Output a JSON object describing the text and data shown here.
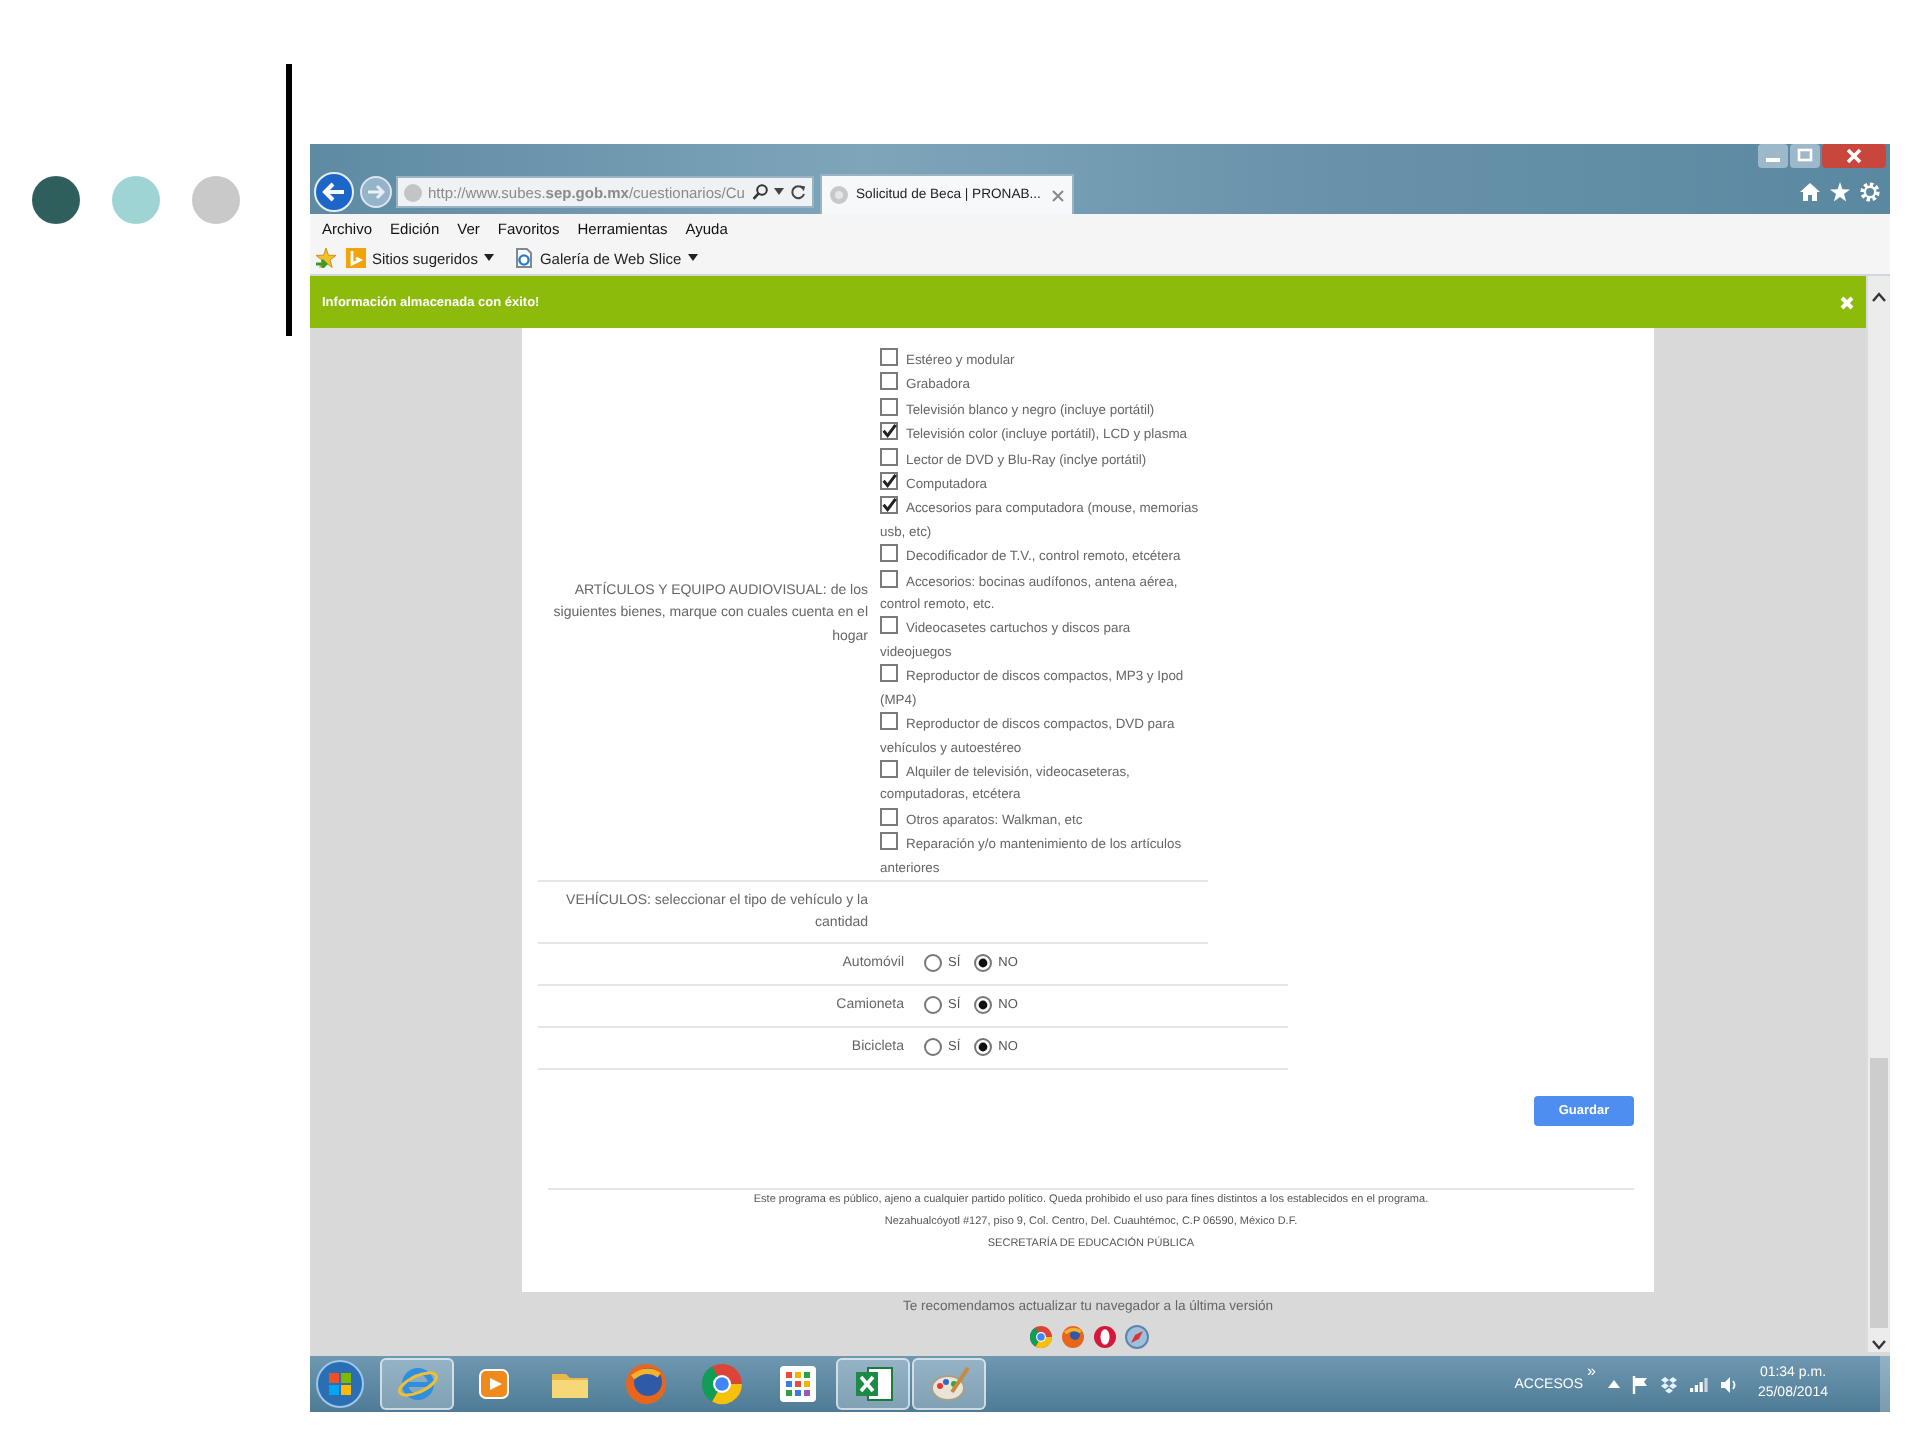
{
  "slide": {
    "dots": [
      {
        "color": "#2f5f5c"
      },
      {
        "color": "#9fd4d4"
      },
      {
        "color": "#c9c9c9"
      }
    ]
  },
  "browser": {
    "address": "http://www.subes.**sep.gob.mx**/cuestionarios/Cu",
    "tab": {
      "title": "Solicitud de Beca | PRONAB..."
    },
    "menu": [
      "Archivo",
      "Edición",
      "Ver",
      "Favoritos",
      "Herramientas",
      "Ayuda"
    ],
    "favorites": [
      {
        "label": "Sitios sugeridos",
        "kind": "logo"
      },
      {
        "label": "Galería de Web Slice",
        "kind": "page"
      }
    ]
  },
  "notification": {
    "message": "Información almacenada con éxito!"
  },
  "form": {
    "checklist": {
      "label": "ARTÍCULOS Y EQUIPO AUDIOVISUAL: de los siguientes bienes, marque con cuales cuenta en el hogar",
      "options": [
        {
          "label": "Estéreo y modular",
          "checked": false
        },
        {
          "label": "Grabadora",
          "checked": false
        },
        {
          "label": "Televisión blanco y negro (incluye portátil)",
          "checked": false
        },
        {
          "label": "Televisión color (incluye portátil), LCD y plasma",
          "checked": true
        },
        {
          "label": "Lector de DVD y Blu-Ray (inclye portátil)",
          "checked": false
        },
        {
          "label": "Computadora",
          "checked": true
        },
        {
          "label": "Accesorios para computadora (mouse, memorias usb, etc)",
          "checked": true
        },
        {
          "label": "Decodificador de T.V., control remoto, etcétera",
          "checked": false
        },
        {
          "label": "Accesorios: bocinas audífonos, antena aérea, control remoto, etc.",
          "checked": false
        },
        {
          "label": "Videocasetes cartuchos y discos para videojuegos",
          "checked": false
        },
        {
          "label": "Reproductor de discos compactos, MP3 y Ipod (MP4)",
          "checked": false
        },
        {
          "label": "Reproductor de discos compactos, DVD para vehículos y autoestéreo",
          "checked": false
        },
        {
          "label": "Alquiler de televisión, videocaseteras, computadoras, etcétera",
          "checked": false
        },
        {
          "label": "Otros aparatos: Walkman, etc",
          "checked": false
        },
        {
          "label": "Reparación y/o mantenimiento de los artículos anteriores",
          "checked": false
        }
      ]
    },
    "vehicles_heading": "VEHÍCULOS: seleccionar el tipo de vehículo y la cantidad",
    "vehicles": [
      {
        "label": "Automóvil",
        "options": [
          {
            "label": "SÍ",
            "selected": false
          },
          {
            "label": "NO",
            "selected": true
          }
        ]
      },
      {
        "label": "Camioneta",
        "options": [
          {
            "label": "SÍ",
            "selected": false
          },
          {
            "label": "NO",
            "selected": true
          }
        ]
      },
      {
        "label": "Bicicleta",
        "options": [
          {
            "label": "SÍ",
            "selected": false
          },
          {
            "label": "NO",
            "selected": true
          }
        ]
      }
    ],
    "save_button": "Guardar"
  },
  "footer": [
    "Este programa es público, ajeno a cualquier partido político. Queda prohibido el uso para fines distintos a los establecidos en el programa.",
    "Nezahualcóyotl #127, piso 9, Col. Centro, Del. Cuauhtémoc, C.P 06590, México D.F.",
    "SECRETARÍA DE EDUCACIÓN PÚBLICA"
  ],
  "notice": "Te recomendamos actualizar tu navegador a la última versión",
  "browser_icons": [
    {
      "kind": "wheel"
    },
    {
      "kind": "globe"
    },
    {
      "kind": "ring"
    },
    {
      "kind": "compass"
    }
  ],
  "taskbar": {
    "apps": [
      {
        "kind": "orbit",
        "running": true
      },
      {
        "kind": "play",
        "running": false
      },
      {
        "kind": "folder",
        "running": false
      },
      {
        "kind": "globe",
        "running": false
      },
      {
        "kind": "wheel",
        "running": false
      },
      {
        "kind": "grid",
        "running": false
      },
      {
        "kind": "sheet",
        "running": true
      },
      {
        "kind": "palette",
        "running": true
      }
    ],
    "tray_label": "ACCESOS",
    "tray_chevron": "»",
    "time": "01:34 p.m.",
    "date": "25/08/2014"
  }
}
